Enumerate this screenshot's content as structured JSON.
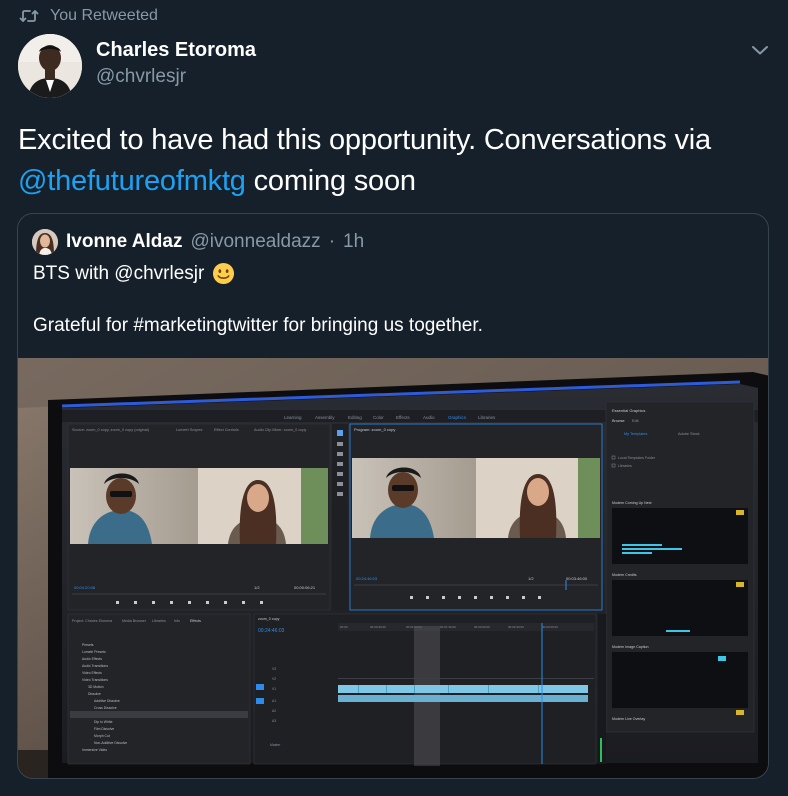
{
  "retweet": {
    "label": "You Retweeted"
  },
  "author": {
    "name": "Charles Etoroma",
    "handle": "@chvrlesjr"
  },
  "tweet": {
    "text_before": "Excited to have had this opportunity. Conversations via ",
    "mention": "@thefutureofmktg",
    "text_after": " coming soon"
  },
  "quoted": {
    "name": "Ivonne Aldaz",
    "handle": "@ivonnealdazz",
    "separator": "·",
    "time": "1h",
    "line1": "BTS with @chvrlesjr",
    "line2": "Grateful for #marketingtwitter for bringing us together.",
    "media": {
      "icon": "photo-of-video-editor",
      "texts": {
        "top_tabs": [
          "Learning",
          "Assembly",
          "Editing",
          "Color",
          "Effects",
          "Audio",
          "Graphics",
          "Libraries"
        ],
        "left_tabs": [
          "Source: zoom_0 copy, zoom_0 copy (original)",
          "Lumetri Scopes",
          "Effect Controls",
          "Audio Clip Mixer: zoom_0 copy"
        ],
        "program_label": "Program: zoom_0 copy",
        "timecode_left": "00:04:20:08",
        "timecode_program": "00:24:46:03",
        "timecode_program_dur": "00:03:46:00",
        "timecode_left_dur": "00:00:06:21",
        "fit_left": "1/2",
        "fit_right": "1/2",
        "timeline_tc": "00:24:46:03",
        "timeline_tab": "zoom_0 copy",
        "time_ticks": [
          "00:00",
          "00:00:30:00",
          "00:01:00:00",
          "00:01:30:00",
          "00:02:00:00",
          "00:02:30:00",
          "00:03:00:00"
        ],
        "project_tabs": [
          "Project: Charles Etoroma",
          "Media Browser",
          "Libraries",
          "Info",
          "Effects"
        ],
        "effects_tree": [
          "Presets",
          "Lumetri Presets",
          "Audio Effects",
          "Audio Transitions",
          "Video Effects",
          "Video Transitions",
          "3D Motion",
          "Dissolve",
          "Additive Dissolve",
          "Cross Dissolve",
          "Dip to Black",
          "Dip to White",
          "Film Dissolve",
          "Morph Cut",
          "Non-Additive Dissolve",
          "Immersive Video"
        ],
        "essential_title": "Essential Graphics",
        "essential_tabs": [
          "Browse",
          "Edit"
        ],
        "essential_options": [
          "My Templates",
          "Adobe Stock"
        ],
        "essential_checks": [
          "Local Templates Folder",
          "Libraries"
        ],
        "templates": [
          "Modern Coming Up Next",
          "Modern Credits",
          "Modern Image Caption",
          "Modern Lower Third",
          "Modern Live Overlay"
        ],
        "track_labels": [
          "V3",
          "V2",
          "V1",
          "A1",
          "A2",
          "A3",
          "Master"
        ]
      }
    }
  },
  "colors": {
    "background": "#15202b",
    "text": "#ffffff",
    "muted": "#8899a6",
    "accent": "#1da1f2",
    "border": "#38444d"
  }
}
